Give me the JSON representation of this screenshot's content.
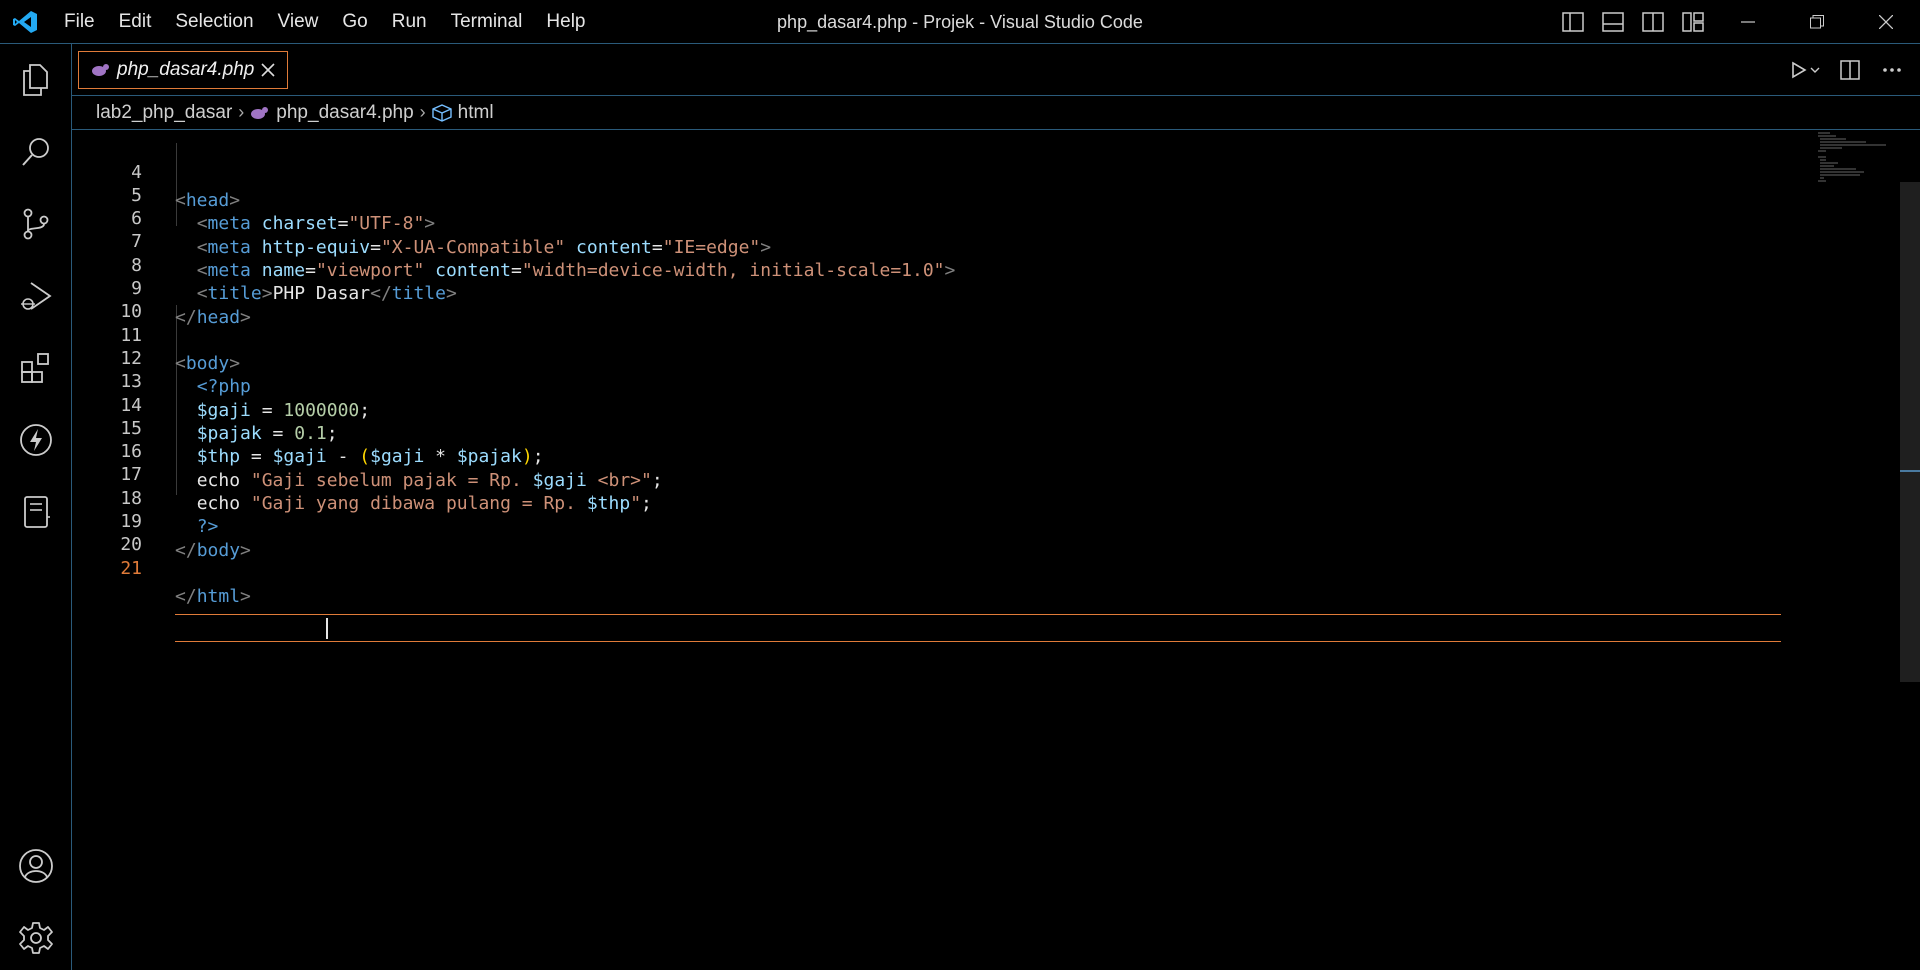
{
  "window": {
    "title": "php_dasar4.php - Projek - Visual Studio Code"
  },
  "menu": [
    "File",
    "Edit",
    "Selection",
    "View",
    "Go",
    "Run",
    "Terminal",
    "Help"
  ],
  "activity_bar": {
    "items": [
      "explorer-icon",
      "search-icon",
      "source-control-icon",
      "run-debug-icon",
      "extensions-icon",
      "thunder-icon",
      "notebook-icon"
    ],
    "bottom": [
      "account-icon",
      "gear-icon"
    ]
  },
  "tab": {
    "label": "php_dasar4.php",
    "accent": "#e07b39"
  },
  "breadcrumb": {
    "folder": "lab2_php_dasar",
    "file": "php_dasar4.php",
    "symbol": "html"
  },
  "editor": {
    "active_line": 21,
    "lines": [
      {
        "n": "4"
      },
      {
        "n": "5"
      },
      {
        "n": "6"
      },
      {
        "n": "7"
      },
      {
        "n": "8"
      },
      {
        "n": "9"
      },
      {
        "n": "10"
      },
      {
        "n": "11"
      },
      {
        "n": "12"
      },
      {
        "n": "13"
      },
      {
        "n": "14"
      },
      {
        "n": "15"
      },
      {
        "n": "16"
      },
      {
        "n": "17"
      },
      {
        "n": "18"
      },
      {
        "n": "19"
      },
      {
        "n": "20"
      },
      {
        "n": "21"
      }
    ],
    "text": {
      "l4": [
        "<",
        "head",
        ">"
      ],
      "l5": [
        "<",
        "meta",
        " ",
        "charset",
        "=",
        "\"UTF-8\"",
        ">"
      ],
      "l6": [
        "<",
        "meta",
        " ",
        "http-equiv",
        "=",
        "\"X-UA-Compatible\"",
        " ",
        "content",
        "=",
        "\"IE=edge\"",
        ">"
      ],
      "l7": [
        "<",
        "meta",
        " ",
        "name",
        "=",
        "\"viewport\"",
        " ",
        "content",
        "=",
        "\"width=device-width, initial-scale=1.0\"",
        ">"
      ],
      "l8": [
        "<",
        "title",
        ">",
        "PHP Dasar",
        "</",
        "title",
        ">"
      ],
      "l9": [
        "</",
        "head",
        ">"
      ],
      "l11": [
        "<",
        "body",
        ">"
      ],
      "l12": [
        "<?php"
      ],
      "l13": [
        "$gaji",
        " = ",
        "1000000",
        ";"
      ],
      "l14": [
        "$pajak",
        " = ",
        "0.1",
        ";"
      ],
      "l15": [
        "$thp",
        " = ",
        "$gaji",
        " - ",
        "(",
        "$gaji",
        " * ",
        "$pajak",
        ")",
        ";"
      ],
      "l16": [
        "echo ",
        "\"Gaji sebelum pajak = Rp. ",
        "$gaji",
        " <br>\"",
        ";"
      ],
      "l17": [
        "echo ",
        "\"Gaji yang dibawa pulang = Rp. ",
        "$thp",
        "\"",
        ";"
      ],
      "l18": [
        "?>"
      ],
      "l19": [
        "</",
        "body",
        ">"
      ],
      "l21": [
        "</",
        "html",
        ">"
      ]
    }
  }
}
